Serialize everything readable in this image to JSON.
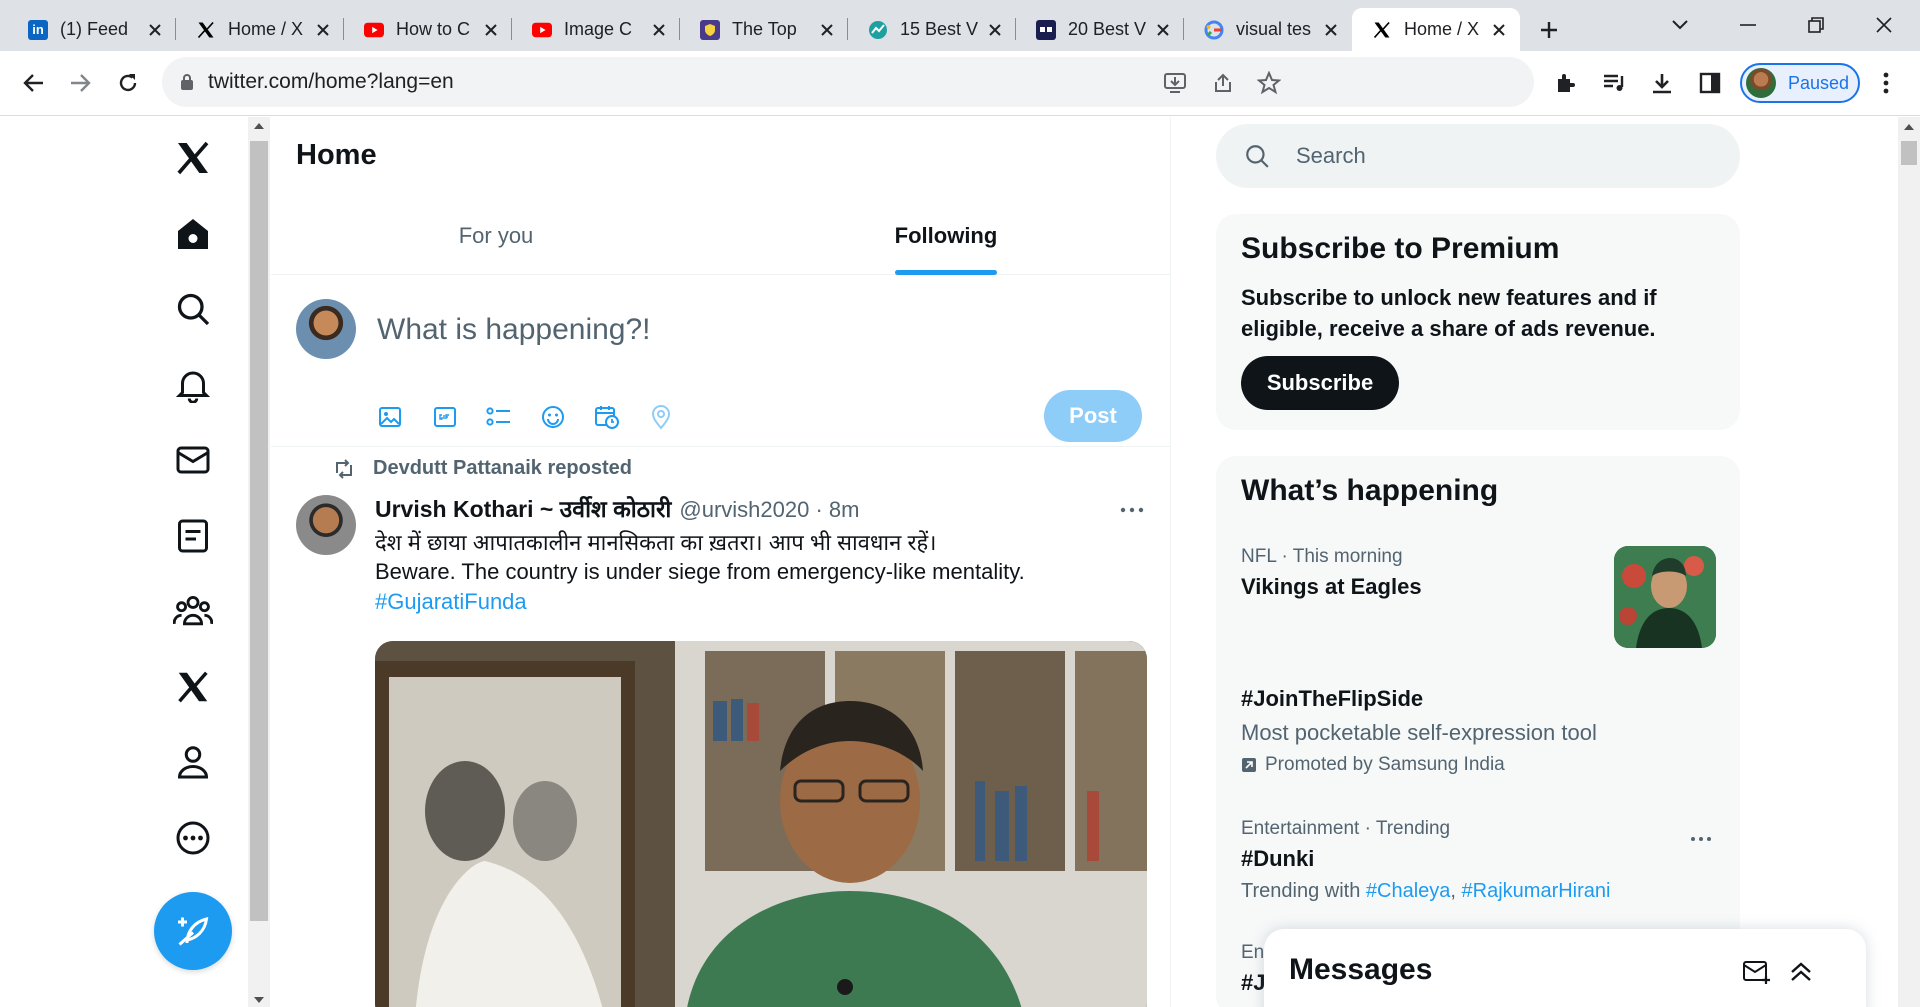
{
  "browser": {
    "tabs": [
      {
        "title": "(1) Feed",
        "favicon": "linkedin-icon",
        "color": "#0a66c2"
      },
      {
        "title": "Home / X",
        "favicon": "x-logo-icon",
        "color": "#000000"
      },
      {
        "title": "How to C",
        "favicon": "youtube-icon",
        "color": "#ff0000"
      },
      {
        "title": "Image C",
        "favicon": "youtube-icon",
        "color": "#ff0000"
      },
      {
        "title": "The Top",
        "favicon": "shield-favicon-icon",
        "color": "#4a3a8a"
      },
      {
        "title": "15 Best V",
        "favicon": "chart-favicon-icon",
        "color": "#1fa0a0"
      },
      {
        "title": "20 Best V",
        "favicon": "qa-favicon-icon",
        "color": "#1a1f4f"
      },
      {
        "title": "visual tes",
        "favicon": "google-icon",
        "color": "#4285f4"
      },
      {
        "title": "Home / X",
        "favicon": "x-logo-icon",
        "color": "#000000",
        "active": true
      }
    ],
    "url": "twitter.com/home?lang=en",
    "profile_label": "Paused"
  },
  "twitter": {
    "page_title": "Home",
    "feed_tabs": [
      {
        "label": "For you",
        "selected": false
      },
      {
        "label": "Following",
        "selected": true
      }
    ],
    "composer": {
      "placeholder": "What is happening?!",
      "post_label": "Post"
    },
    "tweet": {
      "repost_label": "Devdutt Pattanaik reposted",
      "name": "Urvish Kothari ~ उर्वीश कोठारी",
      "handle": "@urvish2020 · 8m",
      "line1": "देश में छाया आपातकालीन मानसिकता का ख़तरा। आप भी सावधान रहें।",
      "line2": "Beware. The country is under siege from emergency-like mentality.",
      "hashtag": "#GujaratiFunda"
    },
    "search_placeholder": "Search",
    "premium": {
      "title": "Subscribe to Premium",
      "description": "Subscribe to unlock new features and if eligible, receive a share of ads revenue.",
      "button": "Subscribe"
    },
    "happening": {
      "title": "What’s happening",
      "trends": [
        {
          "meta": "NFL · This morning",
          "title": "Vikings at Eagles"
        },
        {
          "title": "#JoinTheFlipSide",
          "description": "Most pocketable self-expression tool",
          "promoted": "Promoted by Samsung India"
        },
        {
          "meta": "Entertainment · Trending",
          "title": "#Dunki",
          "with_label": "Trending with",
          "with_tag1": "#Chaleya",
          "with_sep": ", ",
          "with_tag2": "#RajkumarHirani"
        },
        {
          "meta": "En",
          "title": "#J"
        }
      ]
    },
    "messages_title": "Messages"
  },
  "colors": {
    "accent": "#1d9bf0",
    "post_disabled": "#8ecdf8",
    "text": "#0f1419",
    "muted": "#536471"
  }
}
